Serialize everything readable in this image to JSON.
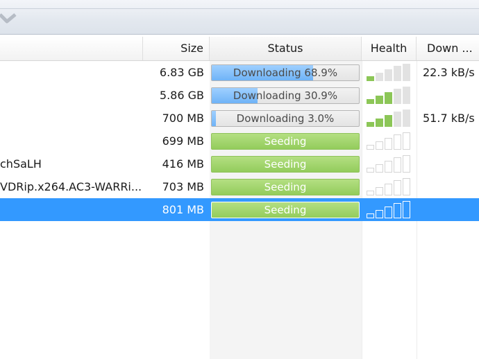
{
  "columns": {
    "size": "Size",
    "status": "Status",
    "health": "Health",
    "down": "Down ..."
  },
  "colors": {
    "accent_selected": "#3399ff",
    "download_fill": "#7fbcf9",
    "seed_fill": "#9dd36a",
    "health_on": "#8cc657"
  },
  "rows": [
    {
      "name": "",
      "size": "6.83 GB",
      "status": "Downloading 68.9%",
      "state": "downloading",
      "progress": 0.689,
      "health": 1,
      "down": "22.3 kB/s"
    },
    {
      "name": "",
      "size": "5.86 GB",
      "status": "Downloading 30.9%",
      "state": "downloading",
      "progress": 0.309,
      "health": 3,
      "down": ""
    },
    {
      "name": "",
      "size": "700 MB",
      "status": "Downloading 3.0%",
      "state": "downloading",
      "progress": 0.03,
      "health": 3,
      "down": "51.7 kB/s"
    },
    {
      "name": "",
      "size": "699 MB",
      "status": "Seeding",
      "state": "seeding",
      "progress": 1,
      "health": 0,
      "down": ""
    },
    {
      "name": "chSaLH",
      "size": "416 MB",
      "status": "Seeding",
      "state": "seeding",
      "progress": 1,
      "health": 0,
      "down": ""
    },
    {
      "name": "VDRip.x264.AC3-WARRi...",
      "size": "703 MB",
      "status": "Seeding",
      "state": "seeding",
      "progress": 1,
      "health": 0,
      "down": ""
    },
    {
      "name": "",
      "size": "801 MB",
      "status": "Seeding",
      "state": "seeding",
      "progress": 1,
      "health": 0,
      "down": "",
      "selected": true
    }
  ]
}
